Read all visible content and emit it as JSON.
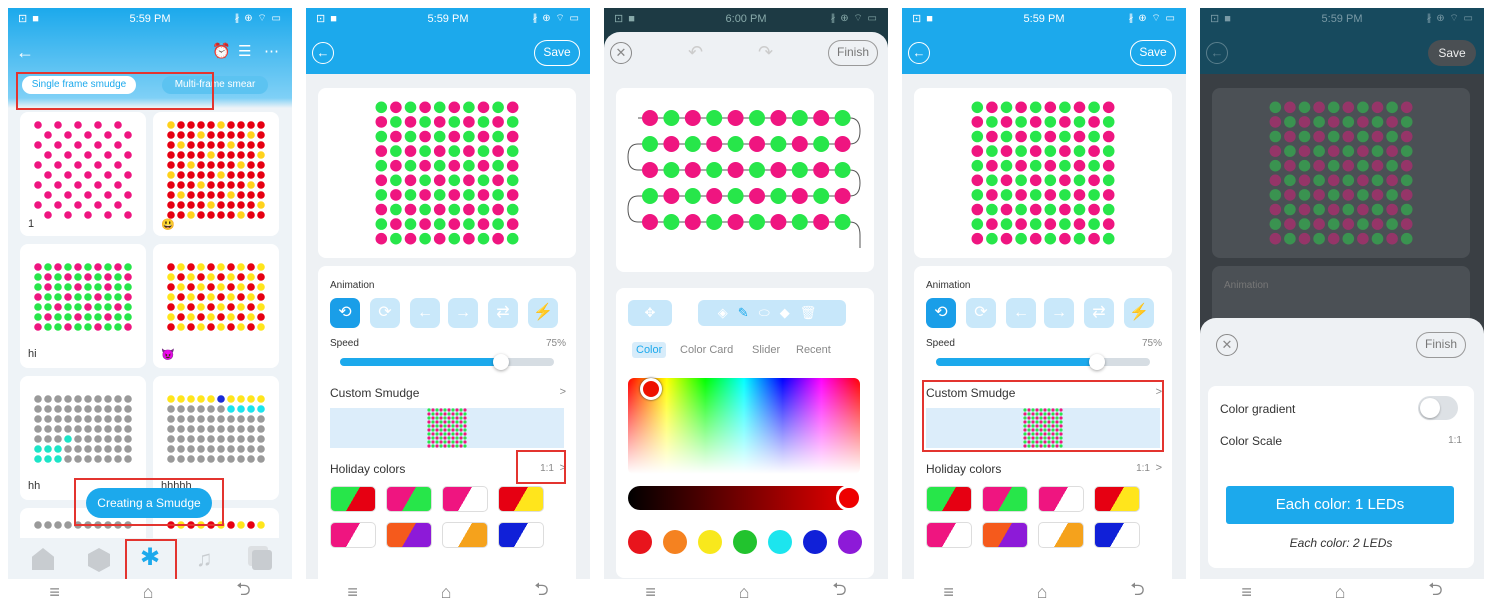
{
  "status": {
    "time": "5:59 PM",
    "time_dim": "6:00 PM",
    "left_icons": "⊡ ■",
    "right_icons": "∦ ⊕ ⌔ ▭"
  },
  "screen1": {
    "tabs": {
      "single": "Single frame smudge",
      "multi": "Multi-frame smear"
    },
    "items": [
      {
        "label": "1"
      },
      {
        "label": "😃"
      },
      {
        "label": "hi"
      },
      {
        "label": "😈"
      },
      {
        "label": "hh"
      },
      {
        "label": "hhhhh"
      }
    ],
    "create_button": "Creating a Smudge"
  },
  "editor": {
    "save": "Save",
    "animation_label": "Animation",
    "speed_label": "Speed",
    "speed_value": "75%",
    "speed_fraction": 0.75,
    "custom_smudge": "Custom Smudge",
    "holiday_colors": "Holiday colors",
    "ratio": "1:1",
    "chevron": ">"
  },
  "picker": {
    "finish": "Finish",
    "tabs": [
      "Color",
      "Color Card",
      "Slider",
      "Recent"
    ],
    "presets": [
      "#e8141c",
      "#f58220",
      "#f8e81c",
      "#22c32e",
      "#1ce5ee",
      "#1020d8",
      "#8d1ad8"
    ]
  },
  "sheet": {
    "finish": "Finish",
    "save": "Save",
    "animation_label": "Animation",
    "gradient_label": "Color gradient",
    "scale_label": "Color Scale",
    "scale_value": "1:1",
    "primary_button": "Each color: 1 LEDs",
    "secondary_text": "Each color: 2 LEDs"
  },
  "colors": {
    "accent": "#1ca9ec",
    "magenta": "#ef1580",
    "green": "#27e64a",
    "red": "#e60012",
    "highlight": "#e3342f"
  }
}
